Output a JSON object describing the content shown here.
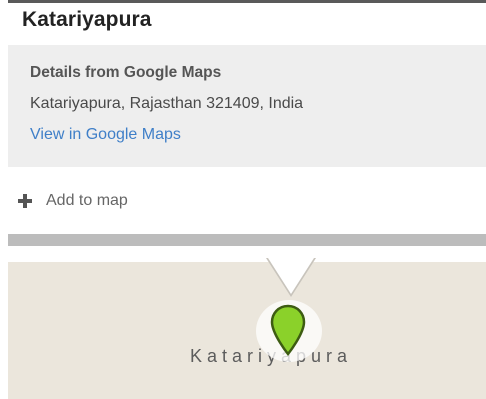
{
  "place": {
    "title": "Katariyapura"
  },
  "details": {
    "heading": "Details from Google Maps",
    "address": "Katariyapura, Rajasthan 321409, India",
    "link_label": "View in Google Maps"
  },
  "actions": {
    "add_to_map_label": "Add to map",
    "add_icon": "plus-icon"
  },
  "map": {
    "label": "Katariyapura",
    "pin_icon": "map-pin-icon",
    "pin_color": "#8bd12a",
    "background_color": "#ebe6dc"
  },
  "colors": {
    "link": "#3f7fc8",
    "panel_bg": "#eeeeee",
    "divider": "#bcbcbc"
  }
}
